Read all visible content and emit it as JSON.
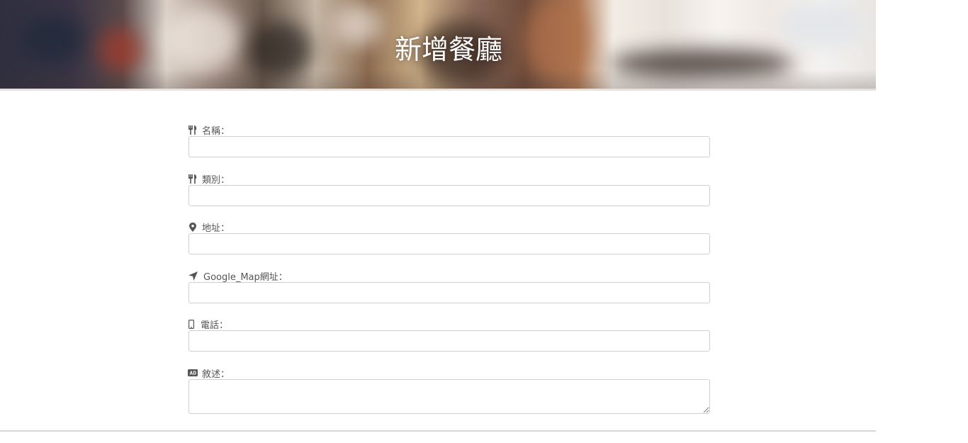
{
  "header": {
    "title": "新增餐廳"
  },
  "form": {
    "fields": [
      {
        "label": "名稱：",
        "icon": "utensils-icon",
        "value": "",
        "placeholder": ""
      },
      {
        "label": "類別：",
        "icon": "utensils-icon",
        "value": "",
        "placeholder": ""
      },
      {
        "label": "地址：",
        "icon": "map-marker-icon",
        "value": "",
        "placeholder": ""
      },
      {
        "label": "Google_Map網址：",
        "icon": "location-arrow-icon",
        "value": "",
        "placeholder": ""
      },
      {
        "label": "電話：",
        "icon": "mobile-phone-icon",
        "value": "",
        "placeholder": ""
      },
      {
        "label": "敘述：",
        "icon": "ad-badge-icon",
        "value": "",
        "placeholder": ""
      }
    ]
  },
  "colors": {
    "label_text": "#555555",
    "input_border": "#cfcfcf",
    "title_text": "#ffffff"
  }
}
